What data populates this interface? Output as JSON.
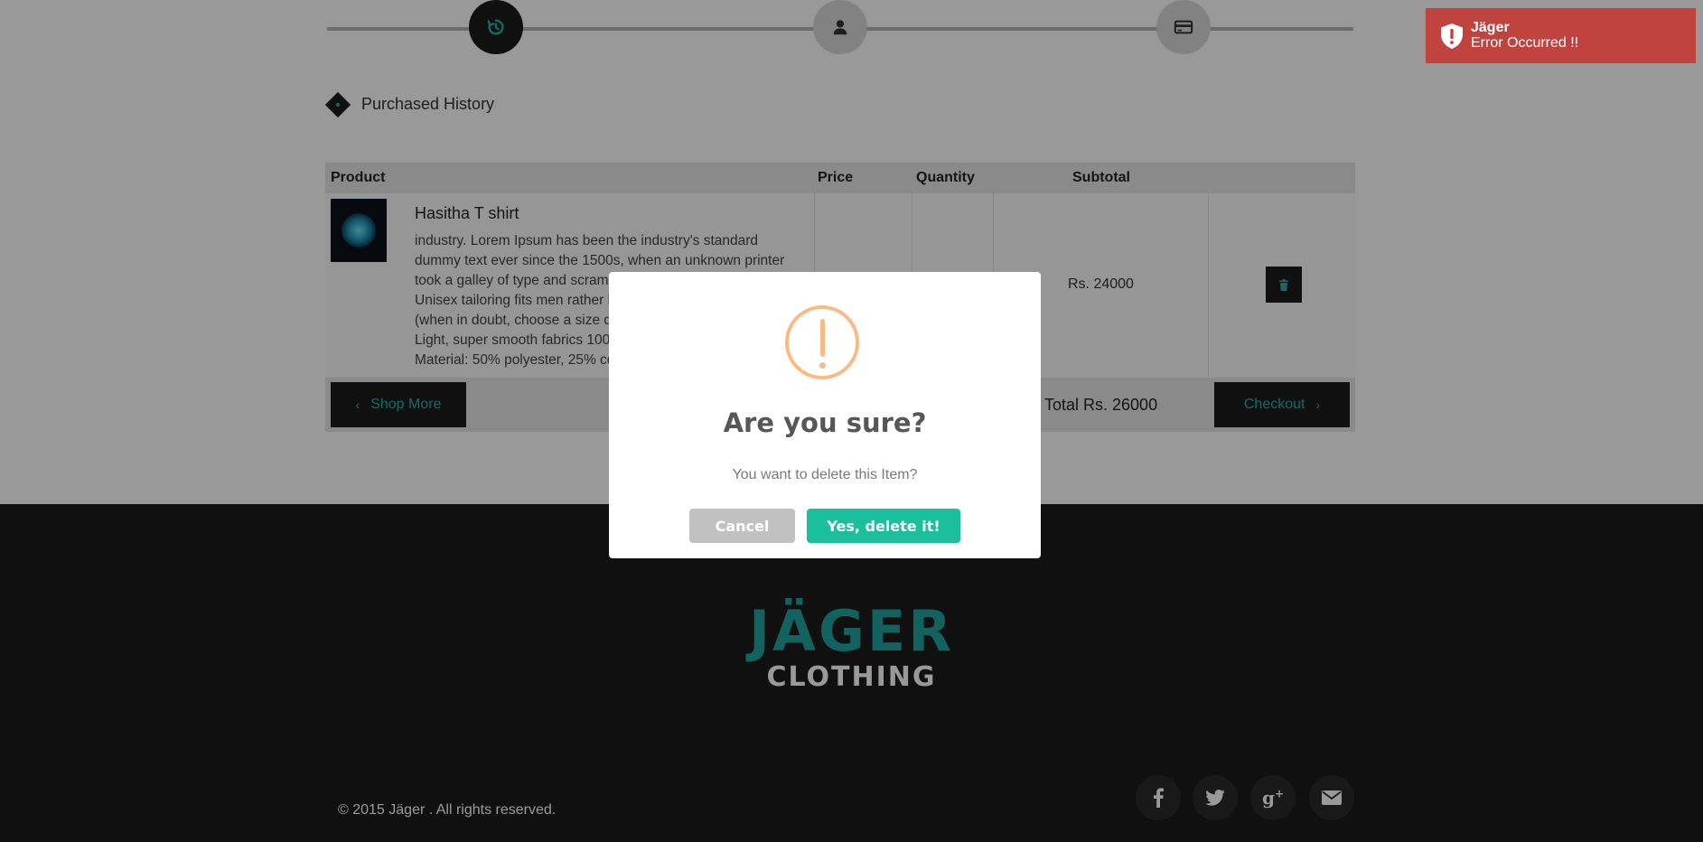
{
  "stepper": {
    "steps": [
      {
        "icon": "history-icon",
        "state": "active"
      },
      {
        "icon": "user-icon",
        "state": "inactive"
      },
      {
        "icon": "credit-card-icon",
        "state": "inactive"
      }
    ]
  },
  "section_title": "Purchased History",
  "cart": {
    "headers": {
      "product": "Product",
      "price": "Price",
      "quantity": "Quantity",
      "subtotal": "Subtotal"
    },
    "items": [
      {
        "name": "Hasitha T shirt",
        "description_lines": [
          "industry. Lorem Ipsum has been the industry's standard",
          "dummy text ever since the 1500s, when an unknown printer",
          "took a galley of type and scrambled it to make a type",
          "Unisex tailoring fits men rather loosely",
          "(when in doubt, choose a size down)",
          "Light, super smooth fabrics 100% cotton",
          "Material: 50% polyester, 25% cotton"
        ],
        "subtotal": "Rs. 24000"
      }
    ],
    "shop_more_label": "Shop More",
    "total_label": "Total Rs. 26000",
    "checkout_label": "Checkout"
  },
  "footer": {
    "brand_line1": "JÄGER",
    "brand_line2": "CLOTHING",
    "copyright": "© 2015 Jäger . All rights reserved.",
    "social": [
      "facebook-icon",
      "twitter-icon",
      "google-plus-icon",
      "mail-icon"
    ]
  },
  "toast": {
    "title": "Jäger",
    "message": "Error Occurred !!",
    "color": "#c04340"
  },
  "modal": {
    "title": "Are you sure?",
    "text": "You want to delete this Item?",
    "cancel_label": "Cancel",
    "confirm_label": "Yes, delete it!",
    "confirm_color": "#1cbf9c",
    "cancel_color": "#c1c1c1",
    "warning_color": "#f8bb86"
  },
  "colors": {
    "accent": "#1fb6a8",
    "dark": "#1b1b1b"
  }
}
